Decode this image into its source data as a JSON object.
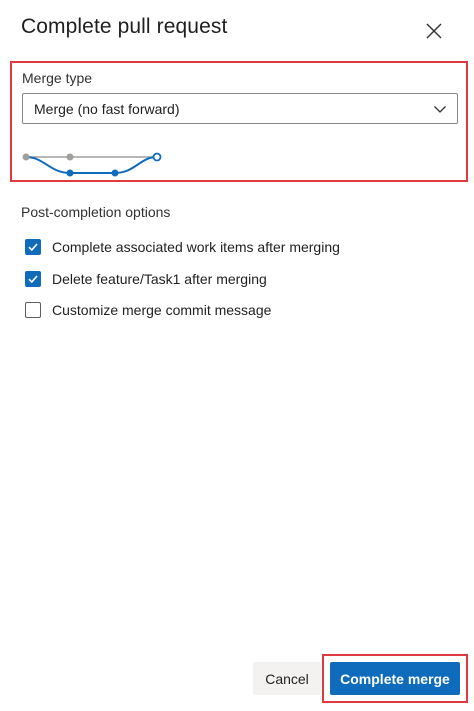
{
  "dialog": {
    "title": "Complete pull request"
  },
  "merge_type": {
    "label": "Merge type",
    "selected": "Merge (no fast forward)",
    "diagram_icon": "merge-no-fast-forward-diagram"
  },
  "post_completion": {
    "label": "Post-completion options",
    "options": [
      {
        "label": "Complete associated work items after merging",
        "checked": true
      },
      {
        "label": "Delete feature/Task1 after merging",
        "checked": true
      },
      {
        "label": "Customize merge commit message",
        "checked": false
      }
    ]
  },
  "footer": {
    "cancel_label": "Cancel",
    "complete_label": "Complete merge"
  },
  "colors": {
    "accent": "#0f6cbd",
    "highlight": "#e0393e",
    "gray_commit": "#a19f9d"
  }
}
